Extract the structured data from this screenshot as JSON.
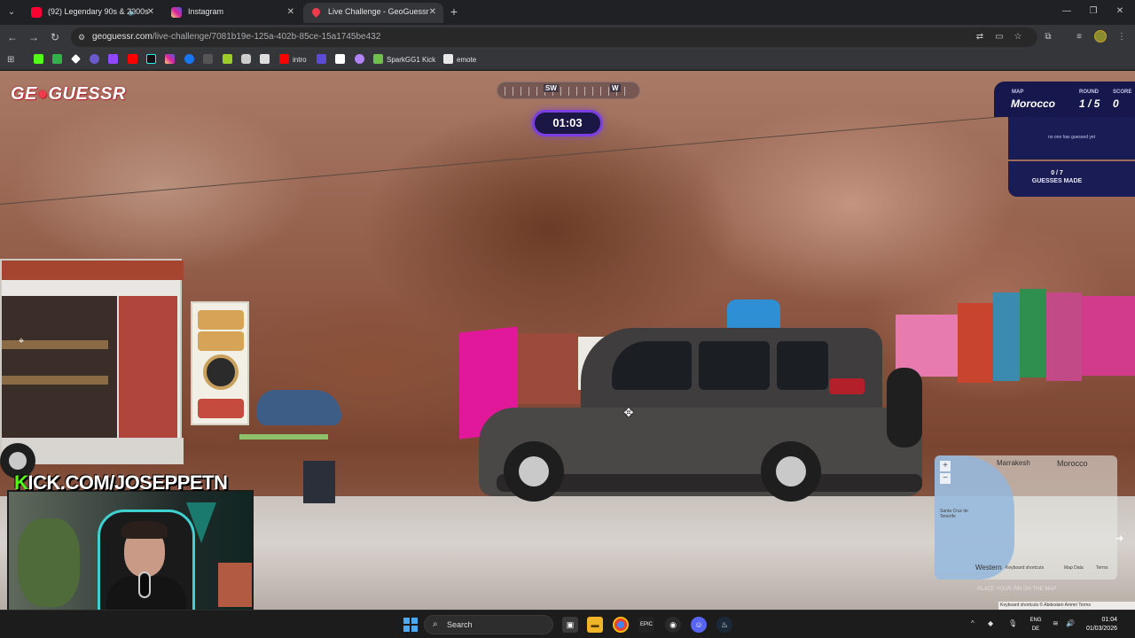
{
  "browser": {
    "tabs": [
      {
        "title": "(92) Legendary 90s & 2000s",
        "favicon_color": "#ff0033",
        "muted_icon": "speaker-icon"
      },
      {
        "title": "Instagram",
        "favicon_color": "#d6249f"
      },
      {
        "title": "Live Challenge - GeoGuessr",
        "favicon_color": "#ef3b4b",
        "active": true
      }
    ],
    "url_host": "geoguessr.com",
    "url_path": "/live-challenge/7081b19e-125a-402b-85ce-15a1745be432",
    "bookmarks": [
      {
        "label": "",
        "color": "#53fc18"
      },
      {
        "label": "",
        "color": "#33b24a"
      },
      {
        "label": "",
        "color": "#ffffff"
      },
      {
        "label": "",
        "color": "#6a5acd"
      },
      {
        "label": "",
        "color": "#9146ff"
      },
      {
        "label": "",
        "color": "#ff0000"
      },
      {
        "label": "",
        "color": "#111111"
      },
      {
        "label": "",
        "color": "#d6249f"
      },
      {
        "label": "",
        "color": "#1877f2"
      },
      {
        "label": "",
        "color": "#555555"
      },
      {
        "label": "",
        "color": "#9ccc2a"
      },
      {
        "label": "",
        "color": "#cccccc"
      },
      {
        "label": "",
        "color": "#dddddd"
      },
      {
        "label": "intro",
        "color": "#ff0000"
      },
      {
        "label": "",
        "color": "#5b4bd6"
      },
      {
        "label": "",
        "color": "#ffffff"
      },
      {
        "label": "",
        "color": "#b084f5"
      },
      {
        "label": "SparkGG1 Kick",
        "color": "#ffffff"
      },
      {
        "label": "emote",
        "color": "#ffffff"
      }
    ]
  },
  "game": {
    "logo_text_left": "GE",
    "logo_text_right": "GUESSR",
    "compass": {
      "sw": "SW",
      "w": "W"
    },
    "timer": "01:03",
    "info": {
      "map_label": "MAP",
      "map_value": "Morocco",
      "round_label": "ROUND",
      "round_value": "1 / 5",
      "score_label": "SCORE",
      "score_value": "0",
      "no_guess_text": "no one has guessed yet",
      "guess_count": "0 / 7",
      "guesses_label": "GUESSES MADE"
    },
    "minimap": {
      "city_label": "Marrakesh",
      "country_label": "Morocco",
      "sea_label": "Santa Cruz de Tenerife",
      "western_label": "Western",
      "keyboard_shortcuts": "Keyboard shortcuts",
      "map_data": "Map Data",
      "terms": "Terms",
      "faint_text": "PLACE YOUR PIN ON THE MAP",
      "zoom_in": "+",
      "zoom_out": "−"
    },
    "attribution": "Keyboard shortcuts  © Abdeslam Ammri  Terms"
  },
  "stream": {
    "kick_prefix": "K",
    "kick_rest": "ICK.COM/JOSEPPETN"
  },
  "taskbar": {
    "search_placeholder": "Search",
    "lang_top": "ENG",
    "lang_bottom": "DE",
    "time": "01:04",
    "date": "01/03/2026"
  }
}
